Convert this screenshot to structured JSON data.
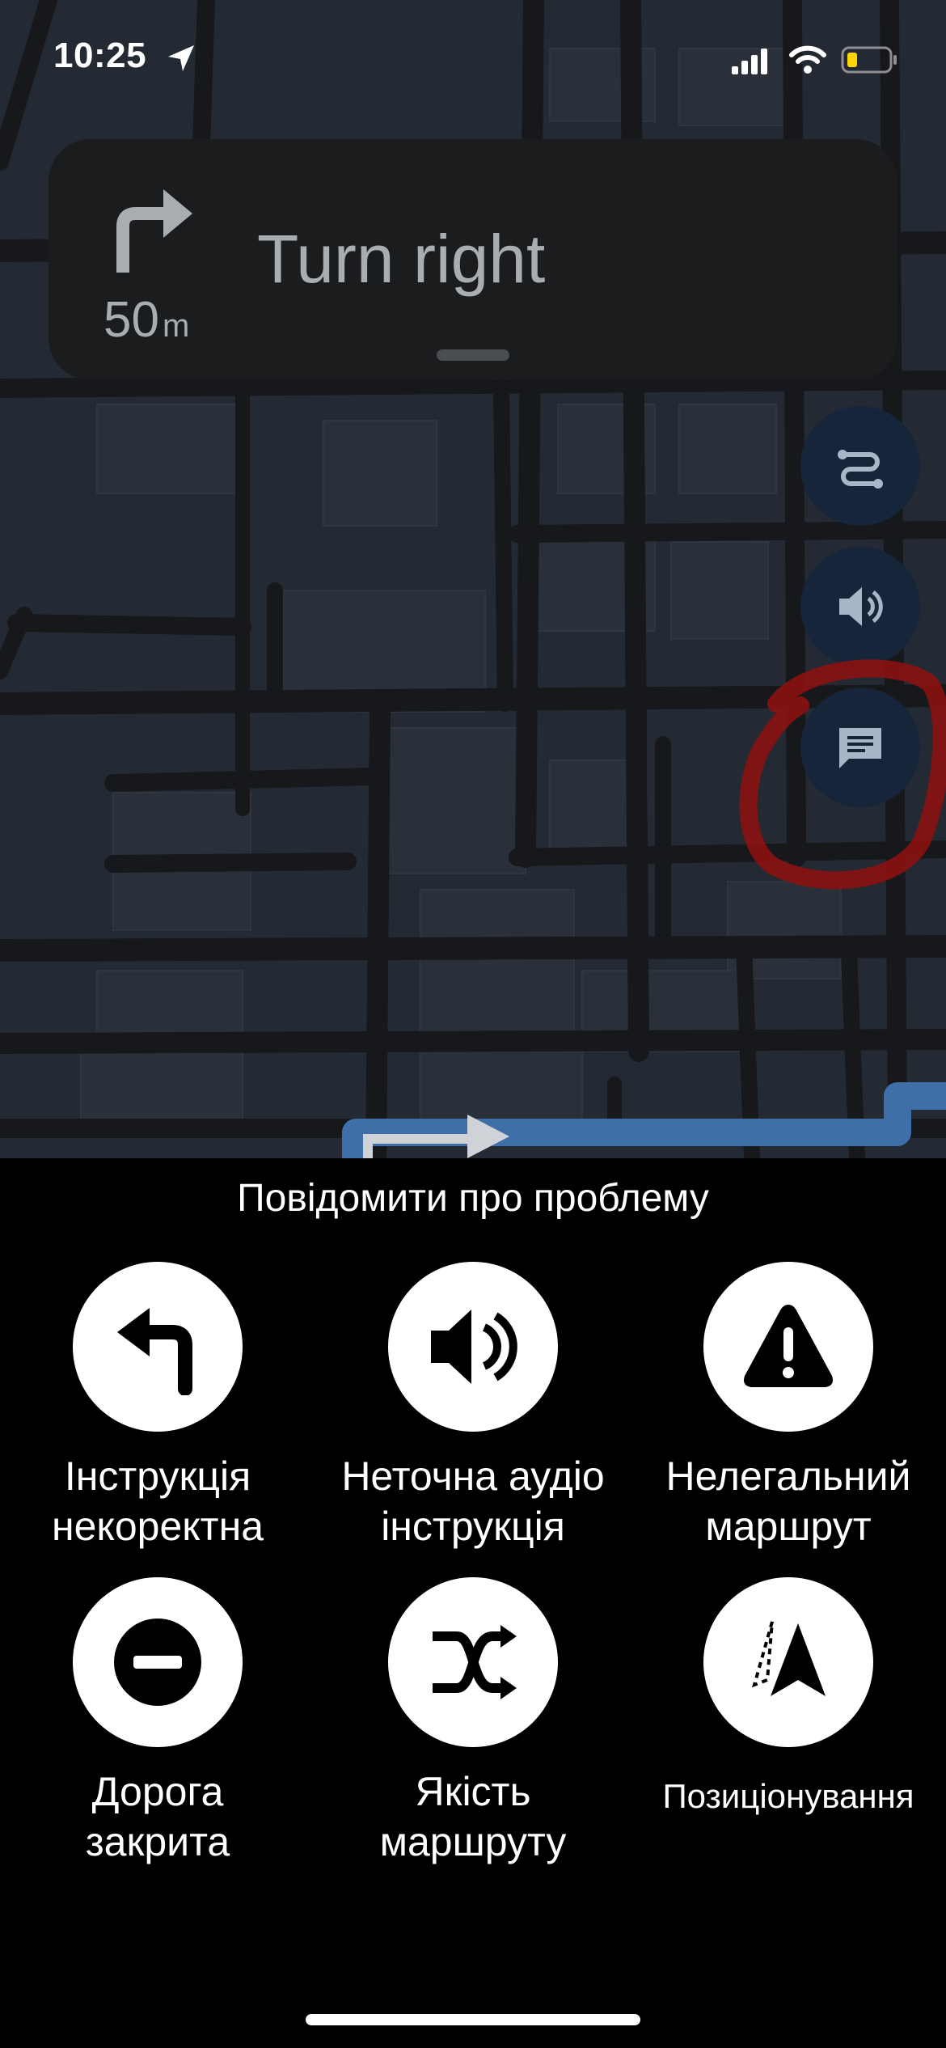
{
  "status_bar": {
    "time": "10:25",
    "icons": [
      "location-arrow-icon",
      "cellular-signal-icon",
      "wifi-icon",
      "battery-low-icon"
    ]
  },
  "navigation": {
    "distance_value": "50",
    "distance_unit": "m",
    "instruction": "Turn right",
    "maneuver_icon": "turn-right-arrow-icon"
  },
  "map_buttons": [
    "route-options-icon",
    "sound-icon",
    "report-chat-icon"
  ],
  "report_sheet": {
    "title": "Повідомити про проблему",
    "options": [
      {
        "icon": "turn-left-arrow-icon",
        "label_line1": "Інструкція",
        "label_line2": "некоректна"
      },
      {
        "icon": "speaker-icon",
        "label_line1": "Неточна аудіо",
        "label_line2": "інструкція"
      },
      {
        "icon": "warning-icon",
        "label_line1": "Нелегальний",
        "label_line2": "маршрут"
      },
      {
        "icon": "no-entry-icon",
        "label_line1": "Дорога",
        "label_line2": "закрита"
      },
      {
        "icon": "shuffle-route-icon",
        "label_line1": "Якість",
        "label_line2": "маршруту"
      },
      {
        "icon": "position-arrow-icon",
        "label_line1": "Позиціонування",
        "label_line2": ""
      }
    ]
  },
  "colors": {
    "map_background": "#242a33",
    "road": "#16181c",
    "route": "#3e6fa8",
    "card_background": "#1b1c1e",
    "button_background": "#16253a",
    "annotation_red": "#8b1111"
  }
}
